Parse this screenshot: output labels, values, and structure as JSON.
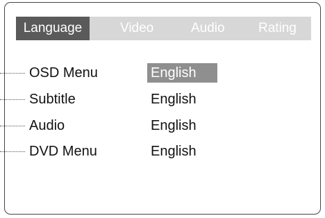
{
  "tabs": [
    {
      "label": "Language",
      "active": true
    },
    {
      "label": "Video",
      "active": false
    },
    {
      "label": "Audio",
      "active": false
    },
    {
      "label": "Rating",
      "active": false
    }
  ],
  "settings": [
    {
      "label": "OSD Menu",
      "value": "English",
      "selected": true
    },
    {
      "label": "Subtitle",
      "value": "English",
      "selected": false
    },
    {
      "label": "Audio",
      "value": "English",
      "selected": false
    },
    {
      "label": "DVD Menu",
      "value": "English",
      "selected": false
    }
  ],
  "colors": {
    "tabbar_background": "#d7d7d7",
    "active_tab": "#5a5a5a",
    "selected_value": "#8f8f8f",
    "inactive_tab_text": "#ffffff"
  }
}
